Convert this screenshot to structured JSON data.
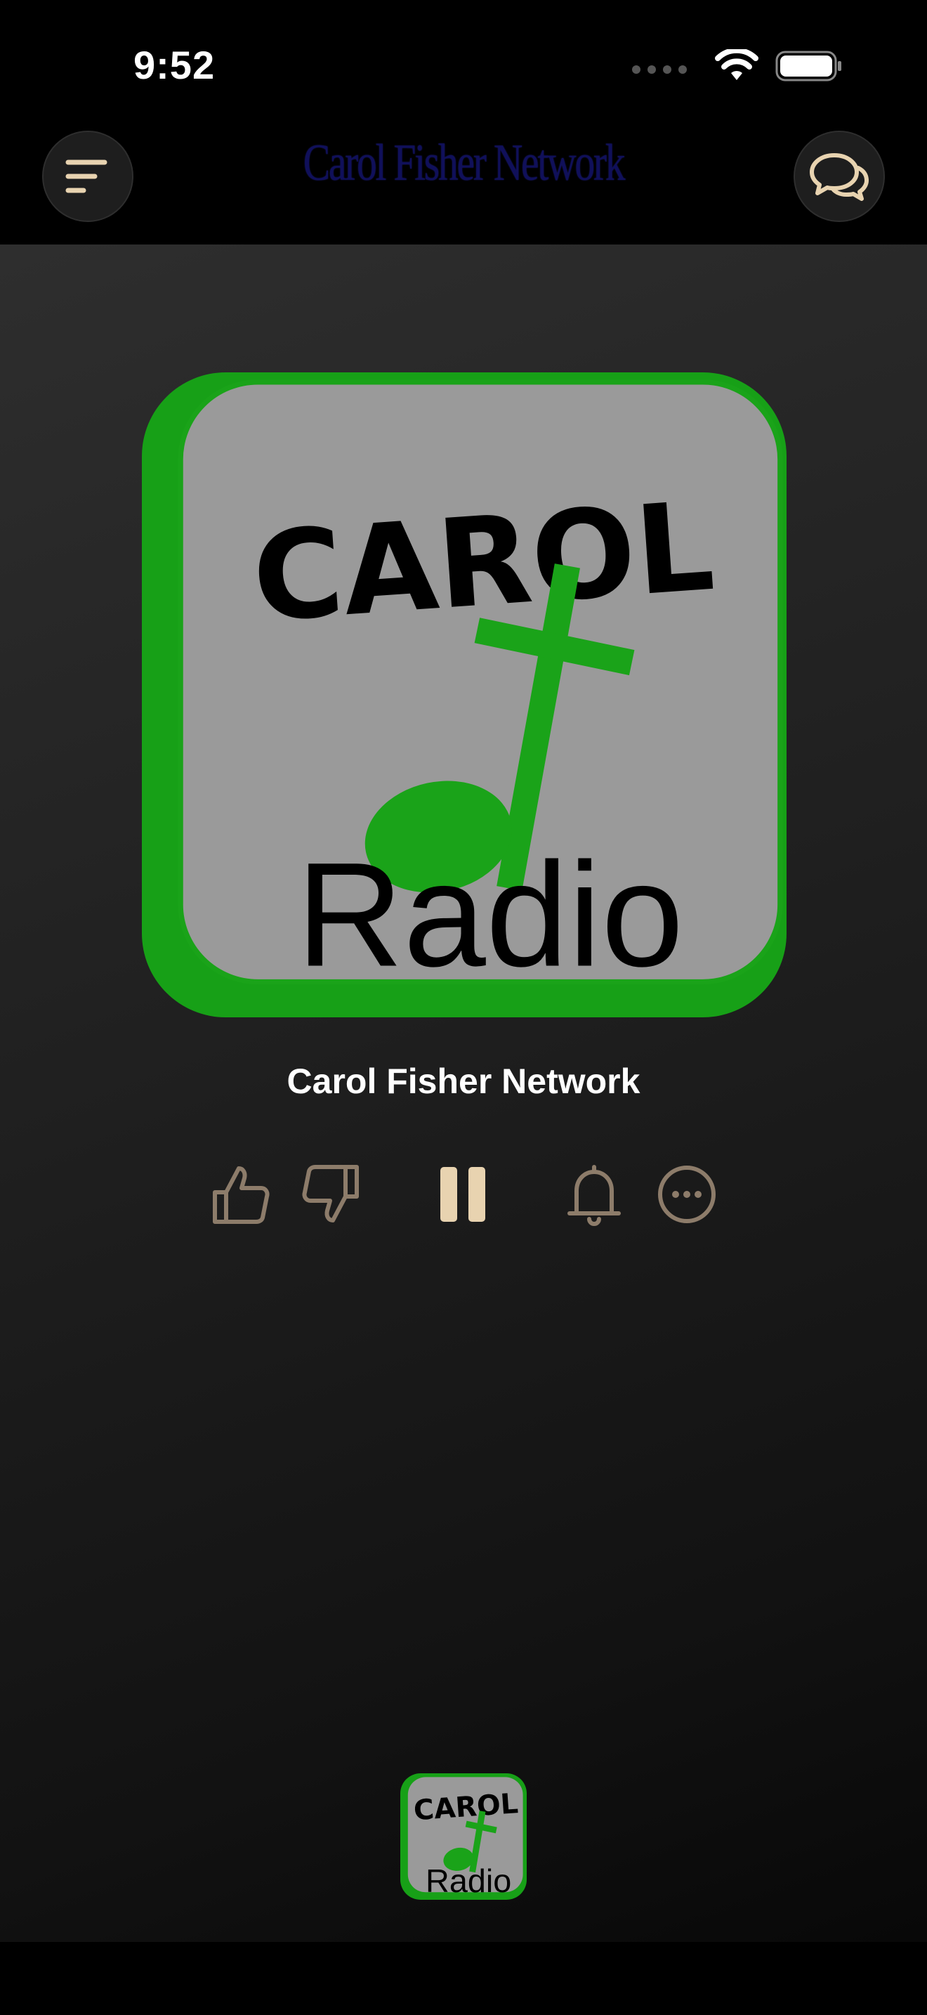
{
  "status_bar": {
    "time": "9:52"
  },
  "header": {
    "title": "Carol Fisher Network",
    "menu_icon": "menu-lines-icon",
    "chat_icon": "chat-bubbles-icon"
  },
  "now_playing": {
    "artwork_logo_text": [
      "CAROL",
      "Radio"
    ],
    "station_name": "Carol Fisher Network",
    "mini_logo_text": [
      "CAROL",
      "Radio"
    ]
  },
  "controls": {
    "icons": [
      "thumbs-up-icon",
      "thumbs-down-icon",
      "pause-icon",
      "bell-icon",
      "more-icon"
    ]
  },
  "colors": {
    "accent": "#e8d3b0",
    "control_icon": "#8d7c6a",
    "logo_green": "#1aa319",
    "logo_gray": "#9a9a9a",
    "header_title": "#10105a"
  }
}
